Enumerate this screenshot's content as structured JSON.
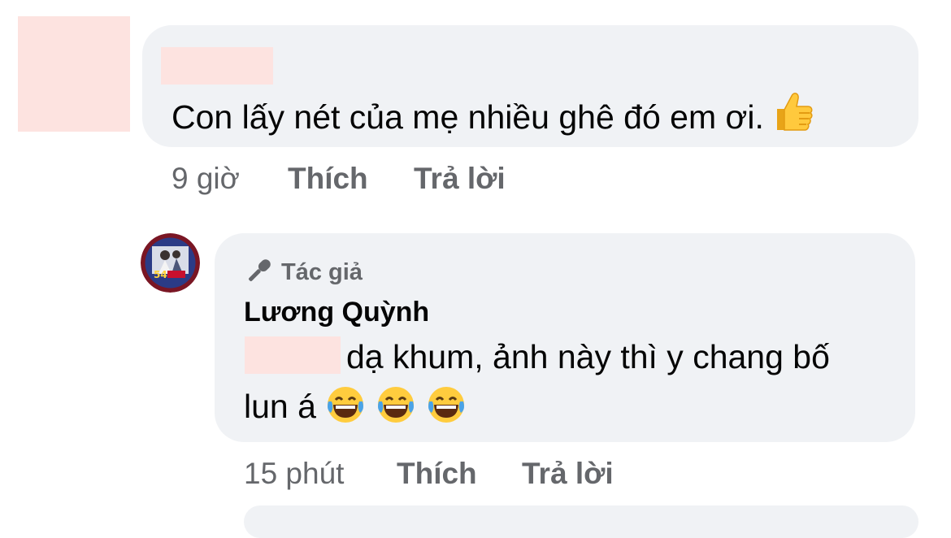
{
  "comment": {
    "text": "Con lấy nét của mẹ nhiều ghê đó em ơi.",
    "reaction_icon": "thumbs-up-emoji",
    "time": "9 giờ",
    "like_label": "Thích",
    "reply_label": "Trả lời"
  },
  "reply": {
    "author_badge_icon": "microphone-icon",
    "author_badge": "Tác giả",
    "author_name": "Lương Quỳnh",
    "text_line_1": "dạ khum, ảnh này thì y chang bố",
    "text_line_2": "lun á",
    "emoji_icons": [
      "laughing-tears-emoji",
      "laughing-tears-emoji",
      "laughing-tears-emoji"
    ],
    "time": "15 phút",
    "like_label": "Thích",
    "reply_label": "Trả lời"
  },
  "colors": {
    "bubble": "#f0f2f5",
    "meta_text": "#65676b",
    "redaction": "#fde3e0"
  }
}
